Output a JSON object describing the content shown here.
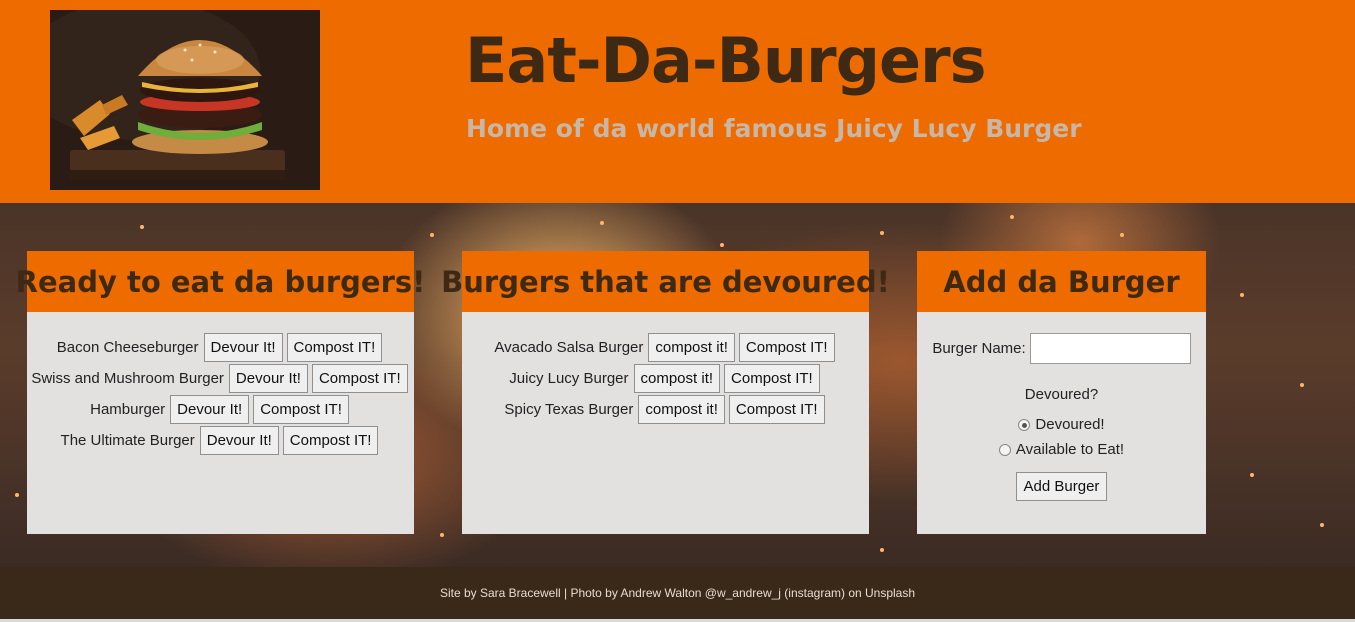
{
  "header": {
    "title": "Eat-Da-Burgers",
    "subtitle": "Home of da world famous Juicy Lucy Burger",
    "logo_icon": "burger-photo"
  },
  "ready_panel": {
    "title": "Ready to eat da burgers!",
    "items": [
      {
        "name": "Bacon Cheeseburger",
        "devour_label": "Devour It!",
        "compost_label": "Compost IT!"
      },
      {
        "name": "Swiss and Mushroom Burger",
        "devour_label": "Devour It!",
        "compost_label": "Compost IT!"
      },
      {
        "name": "Hamburger",
        "devour_label": "Devour It!",
        "compost_label": "Compost IT!"
      },
      {
        "name": "The Ultimate Burger",
        "devour_label": "Devour It!",
        "compost_label": "Compost IT!"
      }
    ]
  },
  "devoured_panel": {
    "title": "Burgers that are devoured!",
    "items": [
      {
        "name": "Avacado Salsa Burger",
        "compost_small_label": "compost it!",
        "compost_label": "Compost IT!"
      },
      {
        "name": "Juicy Lucy Burger",
        "compost_small_label": "compost it!",
        "compost_label": "Compost IT!"
      },
      {
        "name": "Spicy Texas Burger",
        "compost_small_label": "compost it!",
        "compost_label": "Compost IT!"
      }
    ]
  },
  "add_panel": {
    "title": "Add da Burger",
    "name_label": "Burger Name:",
    "name_value": "",
    "question": "Devoured?",
    "option_devoured": "Devoured!",
    "option_available": "Available to Eat!",
    "selected_option": "Devoured!",
    "submit_label": "Add Burger"
  },
  "footer": {
    "text": "Site by Sara Bracewell | Photo by Andrew Walton @w_andrew_j (instagram) on Unsplash"
  },
  "colors": {
    "header_bg": "#ee6b00",
    "title_text": "#3d2914",
    "subtitle_text": "#c8b6a6",
    "panel_bg": "#e2e1e0",
    "footer_bg": "#3a2818"
  }
}
